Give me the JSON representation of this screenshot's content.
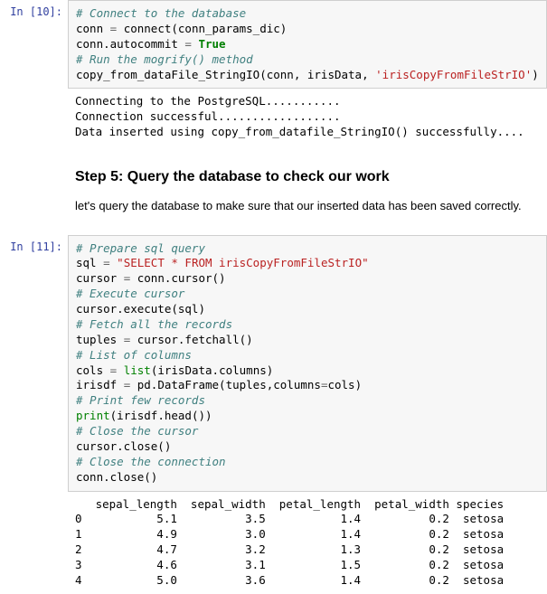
{
  "cells": {
    "c10": {
      "prompt": "In [10]:",
      "code": {
        "l1": {
          "comment": "# Connect to the database"
        },
        "l2": {
          "a": "conn ",
          "op": "=",
          "b": " connect(conn_params_dic)"
        },
        "l3": {
          "a": "conn.autocommit ",
          "op": "=",
          "sp": " ",
          "kw": "True"
        },
        "l4": {
          "comment": "# Run the mogrify() method"
        },
        "l5": {
          "a": "copy_from_dataFile_StringIO(conn, irisData, ",
          "s": "'irisCopyFromFileStrIO'",
          "b": ")"
        }
      },
      "output": "Connecting to the PostgreSQL...........\nConnection successful..................\nData inserted using copy_from_datafile_StringIO() successfully...."
    },
    "md": {
      "h": "Step 5: Query the database to check our work",
      "p": "let's query the database to make sure that our inserted data has been saved correctly."
    },
    "c11": {
      "prompt": "In [11]:",
      "code": {
        "l1": {
          "comment": "# Prepare sql query"
        },
        "l2": {
          "a": "sql ",
          "op": "=",
          "sp": " ",
          "s": "\"SELECT * FROM irisCopyFromFileStrIO\""
        },
        "l3": {
          "a": "cursor ",
          "op": "=",
          "b": " conn.cursor()"
        },
        "l4": {
          "comment": "# Execute cursor"
        },
        "l5": {
          "a": "cursor.execute(sql)"
        },
        "l6": {
          "comment": "# Fetch all the records"
        },
        "l7": {
          "a": "tuples ",
          "op": "=",
          "b": " cursor.fetchall()"
        },
        "l8": {
          "comment": "# List of columns"
        },
        "l9": {
          "a": "cols ",
          "op": "=",
          "sp": " ",
          "nb": "list",
          "b": "(irisData.columns)"
        },
        "l10": {
          "a": "irisdf ",
          "op": "=",
          "b": " pd.DataFrame(tuples,columns",
          "op2": "=",
          "c": "cols)"
        },
        "l11": {
          "comment": "# Print few records"
        },
        "l12": {
          "nb": "print",
          "b": "(irisdf.head())"
        },
        "l13": {
          "comment": "# Close the cursor"
        },
        "l14": {
          "a": "cursor.close()"
        },
        "l15": {
          "comment": "# Close the connection"
        },
        "l16": {
          "a": "conn.close()"
        }
      },
      "output": "   sepal_length  sepal_width  petal_length  petal_width species\n0           5.1          3.5           1.4          0.2  setosa\n1           4.9          3.0           1.4          0.2  setosa\n2           4.7          3.2           1.3          0.2  setosa\n3           4.6          3.1           1.5          0.2  setosa\n4           5.0          3.6           1.4          0.2  setosa"
    }
  },
  "chart_data": {
    "type": "table",
    "title": "irisdf.head()",
    "columns": [
      "sepal_length",
      "sepal_width",
      "petal_length",
      "petal_width",
      "species"
    ],
    "index": [
      0,
      1,
      2,
      3,
      4
    ],
    "rows": [
      [
        5.1,
        3.5,
        1.4,
        0.2,
        "setosa"
      ],
      [
        4.9,
        3.0,
        1.4,
        0.2,
        "setosa"
      ],
      [
        4.7,
        3.2,
        1.3,
        0.2,
        "setosa"
      ],
      [
        4.6,
        3.1,
        1.5,
        0.2,
        "setosa"
      ],
      [
        5.0,
        3.6,
        1.4,
        0.2,
        "setosa"
      ]
    ]
  }
}
